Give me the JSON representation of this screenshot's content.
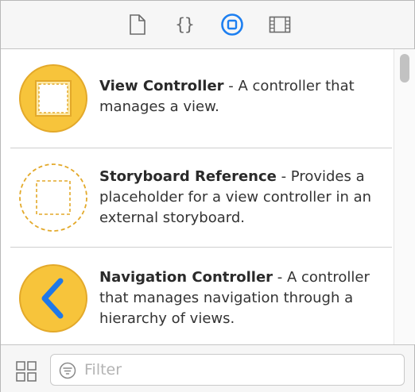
{
  "tabs": [
    {
      "name": "file-inspector",
      "icon": "file-icon",
      "selected": false
    },
    {
      "name": "code-snippets",
      "icon": "braces-icon",
      "label": "{}",
      "selected": false
    },
    {
      "name": "object-library",
      "icon": "object-library-icon",
      "selected": true
    },
    {
      "name": "media-library",
      "icon": "film-icon",
      "selected": false
    }
  ],
  "colors": {
    "accent": "#1d7ff0",
    "item_fill": "#f7c43b",
    "item_stroke": "#e3a92a",
    "chevron": "#1f78e8"
  },
  "library": {
    "items": [
      {
        "title": "View Controller",
        "description": " - A controller that manages a view.",
        "icon": "view-controller-icon"
      },
      {
        "title": "Storyboard Reference",
        "description": " - Provides a placeholder for a view controller in an external storyboard.",
        "icon": "storyboard-reference-icon"
      },
      {
        "title": "Navigation Controller",
        "description": " - A controller that manages navigation through a hierarchy of views.",
        "icon": "navigation-controller-icon"
      }
    ]
  },
  "filter": {
    "placeholder": "Filter",
    "value": ""
  }
}
